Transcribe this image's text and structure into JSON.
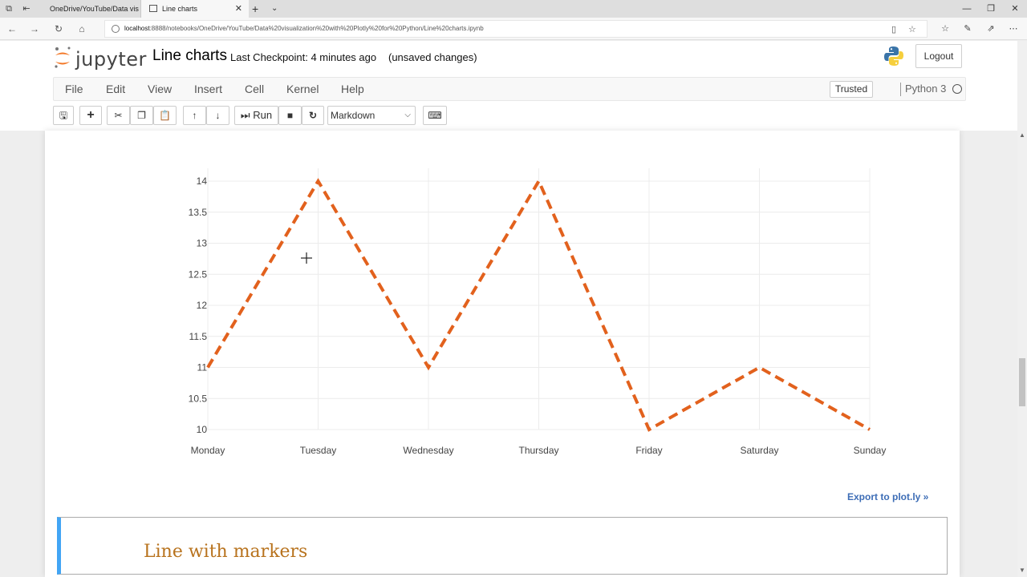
{
  "browser": {
    "tabs": [
      {
        "title": "OneDrive/YouTube/Data vis",
        "active": false
      },
      {
        "title": "Line charts",
        "active": true
      }
    ],
    "url_host": "localhost",
    "url_rest": ":8888/notebooks/OneDrive/YouTube/Data%20visualization%20with%20Plotly%20for%20Python/Line%20charts.ipynb"
  },
  "jupyter": {
    "logo_text": "jupyter",
    "notebook_name": "Line charts",
    "checkpoint": "Last Checkpoint: 4 minutes ago",
    "unsaved": "(unsaved changes)",
    "logout_label": "Logout",
    "menu": [
      "File",
      "Edit",
      "View",
      "Insert",
      "Cell",
      "Kernel",
      "Help"
    ],
    "trusted_label": "Trusted",
    "kernel_name": "Python 3",
    "run_label": "Run",
    "cell_type": "Markdown"
  },
  "chart_data": {
    "type": "line",
    "categories": [
      "Monday",
      "Tuesday",
      "Wednesday",
      "Thursday",
      "Friday",
      "Saturday",
      "Sunday"
    ],
    "series": [
      {
        "values": [
          11,
          14,
          11,
          14,
          10,
          11,
          10
        ],
        "color": "#e2611d",
        "dash": "dash"
      }
    ],
    "yticks": [
      10,
      10.5,
      11,
      11.5,
      12,
      12.5,
      13,
      13.5,
      14
    ],
    "ytick_labels": [
      "10",
      "10.5",
      "11",
      "11.5",
      "12",
      "12.5",
      "13",
      "13.5",
      "14"
    ],
    "ylim": [
      10,
      14
    ],
    "grid": true,
    "title": "",
    "xlabel": "",
    "ylabel": ""
  },
  "export_link": "Export to plot.ly »",
  "markdown_heading": "Line with markers"
}
